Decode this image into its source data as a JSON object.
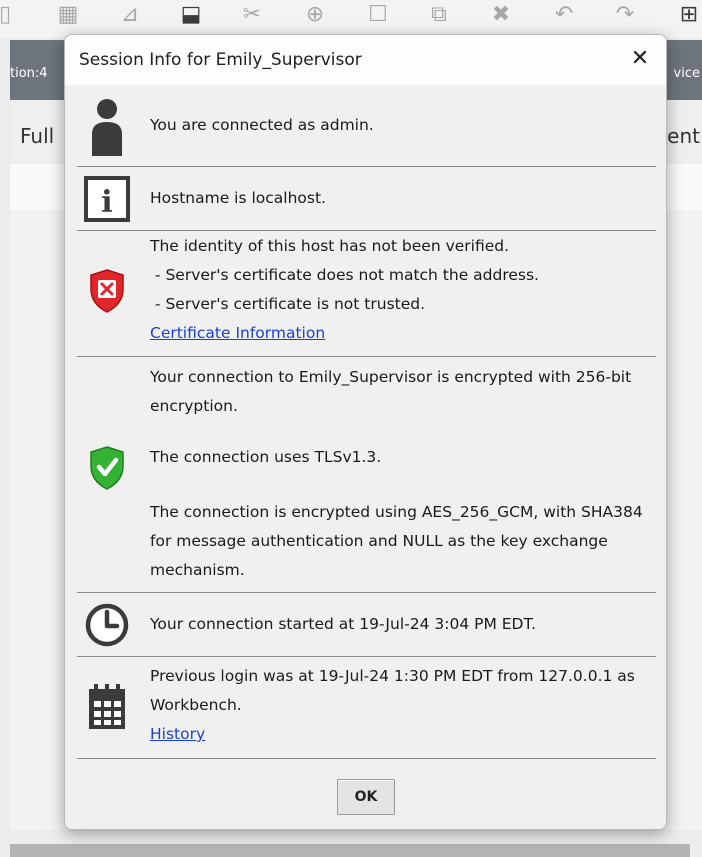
{
  "background": {
    "header_left_text": "tion:4",
    "header_right_text": "vice",
    "subbar_left_text": "Full",
    "subbar_right_text": "ent"
  },
  "dialog": {
    "title": "Session Info for Emily_Supervisor",
    "close_glyph": "✕",
    "sections": {
      "user": {
        "icon": "user-icon",
        "text": "You are connected as admin."
      },
      "host": {
        "icon": "info-icon",
        "text": "Hostname is localhost."
      },
      "identity": {
        "icon": "shield-error-icon",
        "line1": "The identity of this host has not been verified.",
        "line2": " - Server's certificate does not match the address.",
        "line3": " - Server's certificate is not trusted.",
        "link": "Certificate Information"
      },
      "encryption": {
        "icon": "shield-check-icon",
        "line1": "Your connection to Emily_Supervisor is encrypted with 256-bit encryption.",
        "line2": "The connection uses TLSv1.3.",
        "line3": "The connection is encrypted using AES_256_GCM, with SHA384 for message authentication and NULL as the key exchange mechanism."
      },
      "started": {
        "icon": "clock-icon",
        "text": "Your connection started at 19-Jul-24 3:04 PM EDT."
      },
      "previous": {
        "icon": "calendar-icon",
        "text": "Previous login was at 19-Jul-24 1:30 PM EDT from 127.0.0.1 as Workbench.",
        "link": "History"
      }
    },
    "ok_label": "OK"
  },
  "colors": {
    "error_red": "#e0262b",
    "success_green": "#33b233",
    "link_blue": "#1a3fd6",
    "icon_gray": "#3b3b3b"
  }
}
